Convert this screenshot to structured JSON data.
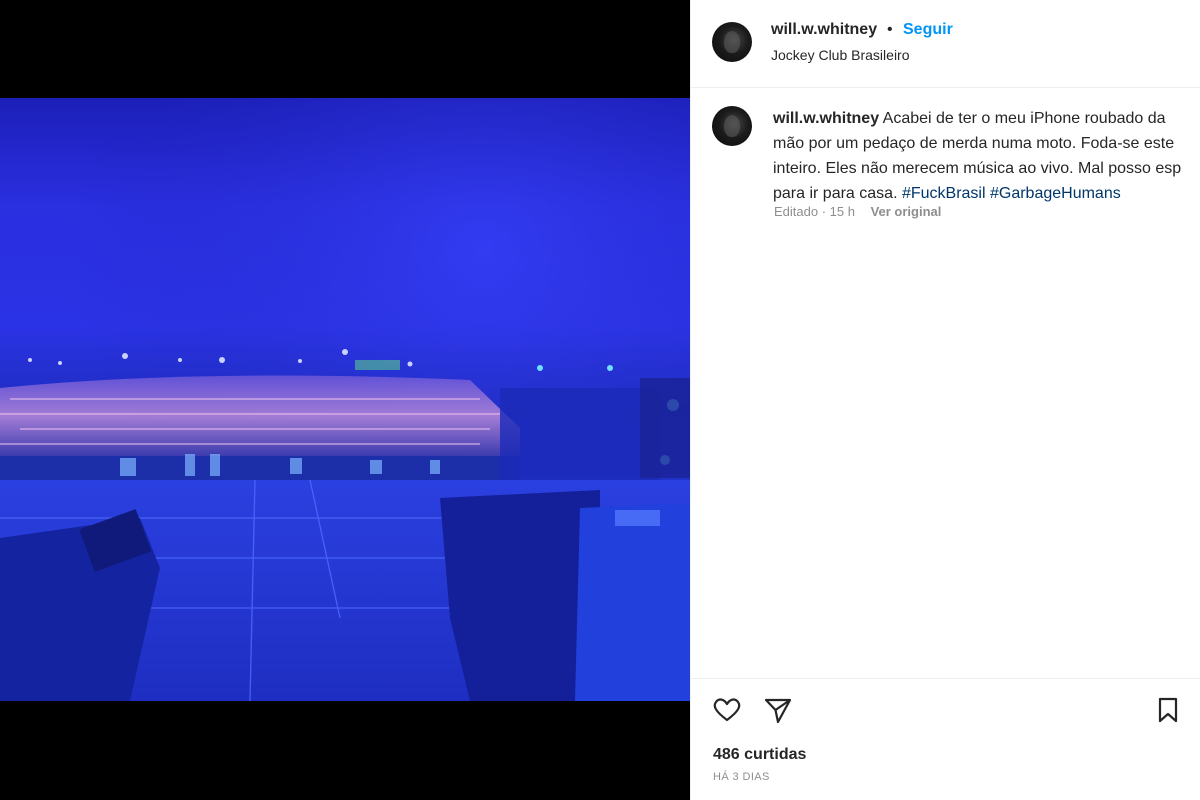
{
  "post": {
    "author": "will.w.whitney",
    "follow_label": "Seguir",
    "separator": "•",
    "location": "Jockey Club Brasileiro"
  },
  "caption": {
    "author": "will.w.whitney",
    "text": "Acabei de ter o meu iPhone roubado da\nmão por um pedaço de merda numa moto. Foda-se este\ninteiro. Eles não merecem música ao vivo. Mal posso esp\npara ir para casa. ",
    "hashtags": [
      "#FuckBrasil",
      "#GarbageHumans"
    ],
    "edited_label": "Editado · 15 h",
    "see_original_label": "Ver original"
  },
  "actions": {
    "like_icon": "heart-icon",
    "share_icon": "paper-plane-icon",
    "save_icon": "bookmark-icon",
    "likes_label": "486 curtidas",
    "time_label": "HÁ 3 DIAS"
  },
  "colors": {
    "accent": "#0095f6",
    "hashtag": "#00376b",
    "muted": "#8e8e8e",
    "photo_blue": "#2a2fe0"
  }
}
